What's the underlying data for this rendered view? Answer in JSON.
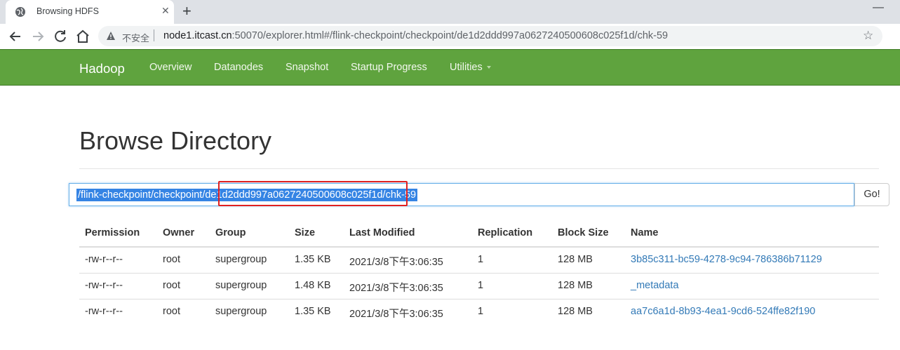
{
  "browser": {
    "tab_title": "Browsing HDFS",
    "tab_close": "✕",
    "new_tab": "+",
    "minimize": "—",
    "insecure_label": "不安全",
    "url_host": "node1.itcast.cn",
    "url_rest": ":50070/explorer.html#/flink-checkpoint/checkpoint/de1d2ddd997a0627240500608c025f1d/chk-59",
    "star": "☆"
  },
  "navbar": {
    "brand": "Hadoop",
    "items": [
      "Overview",
      "Datanodes",
      "Snapshot",
      "Startup Progress",
      "Utilities"
    ]
  },
  "page": {
    "title": "Browse Directory",
    "path_value": "/flink-checkpoint/checkpoint/de1d2ddd997a0627240500608c025f1d/chk-59",
    "go_label": "Go!"
  },
  "table": {
    "headers": [
      "Permission",
      "Owner",
      "Group",
      "Size",
      "Last Modified",
      "Replication",
      "Block Size",
      "Name"
    ],
    "rows": [
      [
        "-rw-r--r--",
        "root",
        "supergroup",
        "1.35 KB",
        "2021/3/8下午3:06:35",
        "1",
        "128 MB",
        "3b85c311-bc59-4278-9c94-786386b71129"
      ],
      [
        "-rw-r--r--",
        "root",
        "supergroup",
        "1.48 KB",
        "2021/3/8下午3:06:35",
        "1",
        "128 MB",
        "_metadata"
      ],
      [
        "-rw-r--r--",
        "root",
        "supergroup",
        "1.35 KB",
        "2021/3/8下午3:06:35",
        "1",
        "128 MB",
        "aa7c6a1d-8b93-4ea1-9cd6-524ffe82f190"
      ]
    ]
  },
  "colors": {
    "navbar_bg": "#5fa33e",
    "link": "#337ab7",
    "highlight_box": "#e02020",
    "selection": "#3584e4"
  }
}
